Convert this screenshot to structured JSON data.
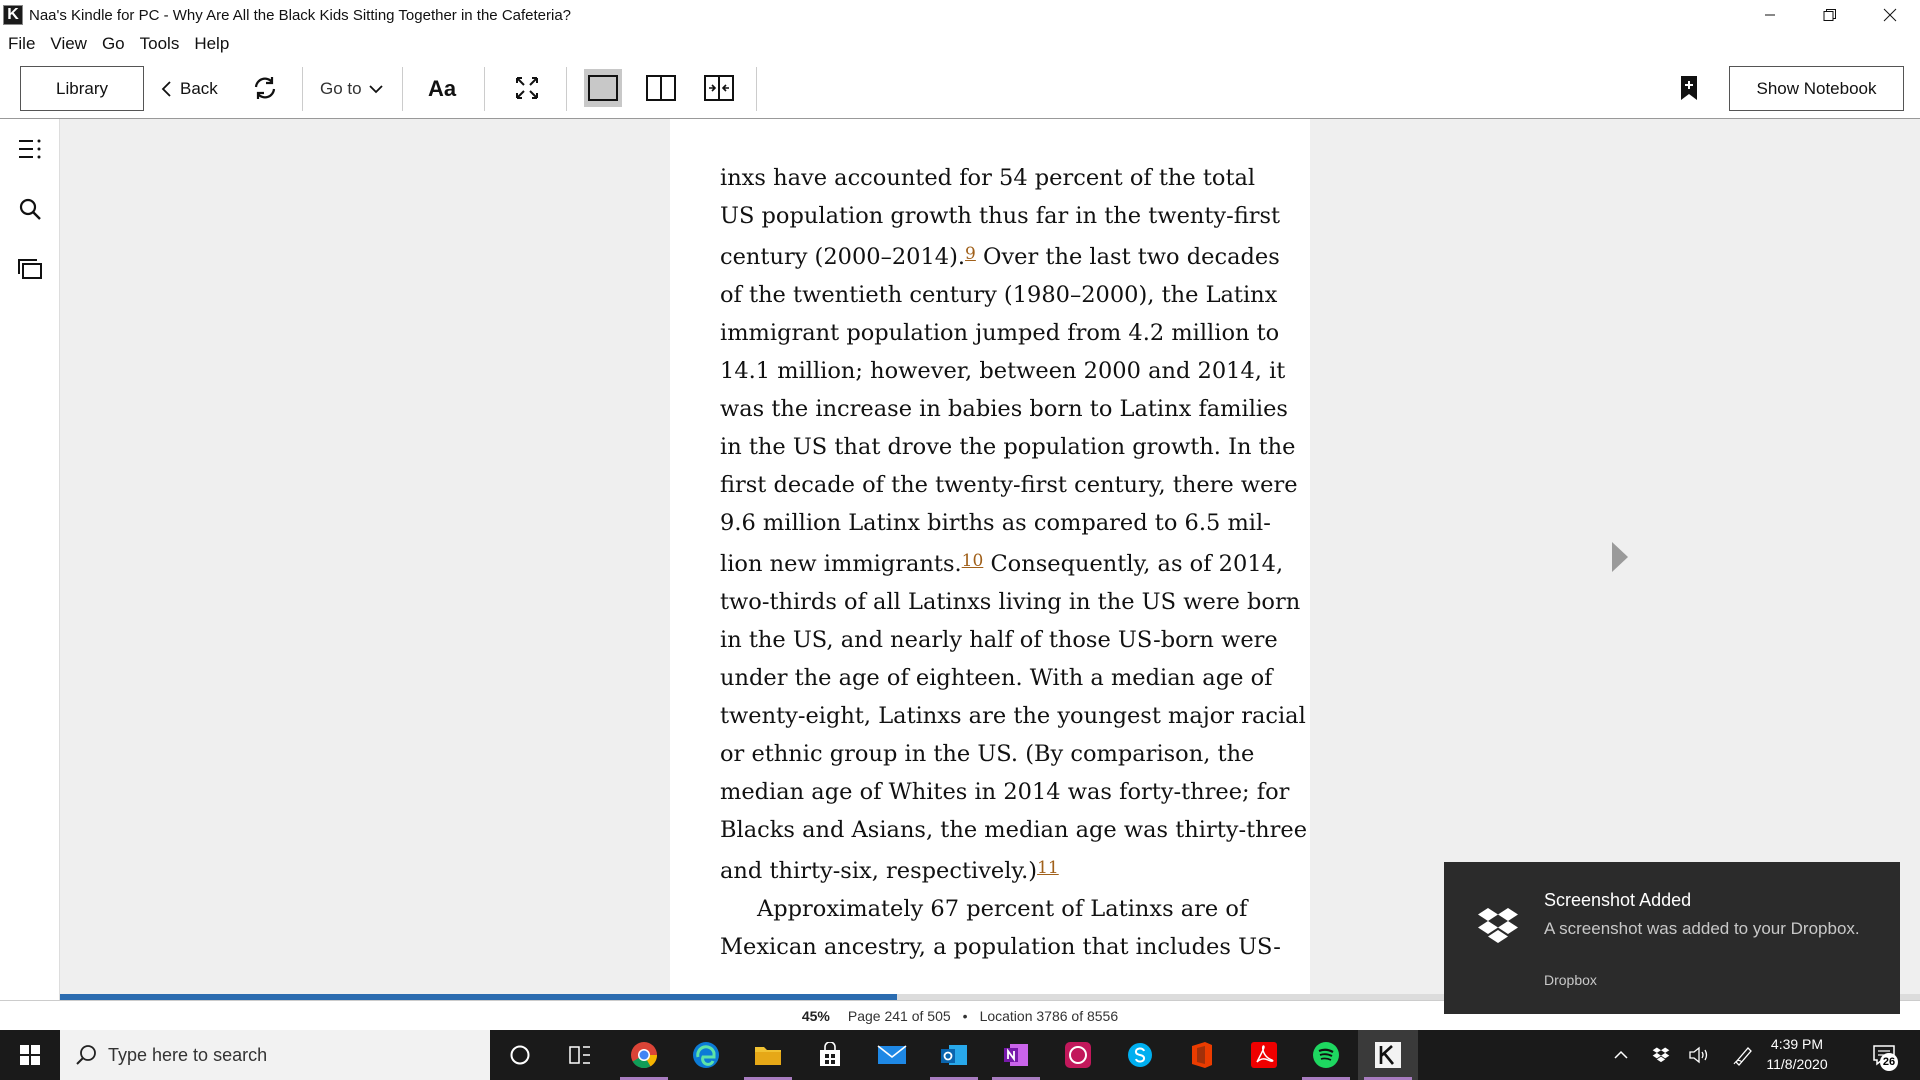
{
  "window": {
    "title": "Naa's Kindle for PC - Why Are All the Black Kids Sitting Together in the Cafeteria?",
    "app_icon_letter": "K"
  },
  "menu": [
    "File",
    "View",
    "Go",
    "Tools",
    "Help"
  ],
  "toolbar": {
    "library_label": "Library",
    "back_label": "Back",
    "goto_label": "Go to",
    "font_label": "Aa",
    "notebook_label": "Show Notebook"
  },
  "book": {
    "lines": [
      {
        "text": "inxs have accounted for 54 percent of the total"
      },
      {
        "text": "US population growth thus far in the twenty-first"
      },
      {
        "text": "century (2000–2014).",
        "fn": "9",
        "after": " Over the last two decades"
      },
      {
        "text": "of the twentieth century (1980–2000), the Latinx"
      },
      {
        "text": "immigrant population jumped from 4.2 million to"
      },
      {
        "text": "14.1 million; however, between 2000 and 2014, it"
      },
      {
        "text": "was the increase in babies born to Latinx families"
      },
      {
        "text": "in the US that drove the population growth. In the"
      },
      {
        "text": "first decade of the twenty-first century, there were"
      },
      {
        "text": "9.6 million Latinx births as compared to 6.5 mil-"
      },
      {
        "text": "lion new immigrants.",
        "fn": "10",
        "after": " Consequently, as of 2014,"
      },
      {
        "text": "two-thirds of all Latinxs living in the US were born"
      },
      {
        "text": "in the US, and nearly half of those US-born were"
      },
      {
        "text": "under the age of eighteen. With a median age of"
      },
      {
        "text": "twenty-eight, Latinxs are the youngest major racial"
      },
      {
        "text": "or ethnic group in the US. (By comparison, the"
      },
      {
        "text": "median age of Whites in 2014 was forty-three; for"
      },
      {
        "text": "Blacks and Asians, the median age was thirty-three"
      },
      {
        "text": "and thirty-six, respectively.)",
        "fn": "11",
        "after": ""
      },
      {
        "text": "Approximately 67 percent of Latinxs are of",
        "indent": true
      },
      {
        "text": "Mexican ancestry, a population that includes US-"
      }
    ]
  },
  "progress": {
    "fraction": 0.45,
    "percent_label": "45%",
    "page_label": "Page 241 of 505",
    "separator": "•",
    "location_label": "Location 3786 of 8556"
  },
  "toast": {
    "title": "Screenshot Added",
    "body": "A screenshot was added to your Dropbox.",
    "source": "Dropbox"
  },
  "taskbar": {
    "search_placeholder": "Type here to search",
    "time": "4:39 PM",
    "date": "11/8/2020",
    "notification_count": "26"
  },
  "colors": {
    "progress_fill": "#2b6cb0",
    "footnote": "#a0601a",
    "toast_bg": "#2b2b2b",
    "taskbar_bg": "#1a1a1a"
  }
}
